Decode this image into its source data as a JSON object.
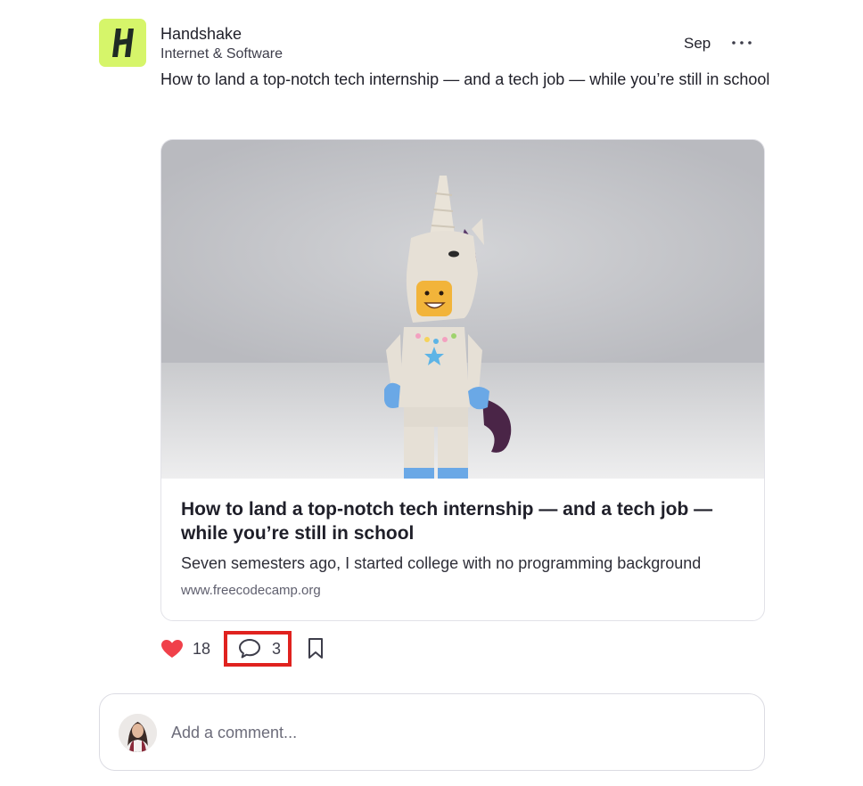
{
  "post": {
    "company_name": "Handshake",
    "company_industry": "Internet & Software",
    "date": "Sep",
    "more_icon": "more-horizontal-icon",
    "text": "How to land a top-notch tech internship — and a tech job — while you’re still in school",
    "link_card": {
      "image_icon": "lego-unicorn-photo",
      "title": "How to land a top-notch tech internship — and a tech job — while you’re still in school",
      "description": "Seven semesters ago, I started college with no programming background",
      "domain": "www.freecodecamp.org"
    },
    "actions": {
      "like_count": "18",
      "comment_count": "3",
      "colors": {
        "like": "#f0404a",
        "highlight": "#e0221f"
      }
    }
  },
  "comment_box": {
    "placeholder": "Add a comment..."
  },
  "colors": {
    "logo_bg": "#d6f56a",
    "logo_fg": "#1f2a24"
  }
}
